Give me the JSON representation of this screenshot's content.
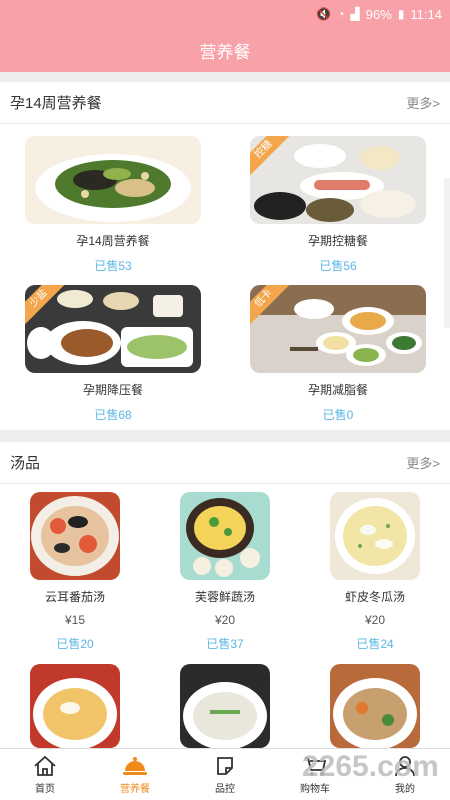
{
  "status": {
    "battery": "96%",
    "time": "11:14"
  },
  "header": {
    "title": "营养餐"
  },
  "section1": {
    "title": "孕14周营养餐",
    "more": "更多>",
    "items": [
      {
        "name": "孕14周营养餐",
        "sold": "已售53",
        "badge": ""
      },
      {
        "name": "孕期控糖餐",
        "sold": "已售56",
        "badge": "控糖"
      },
      {
        "name": "孕期降压餐",
        "sold": "已售68",
        "badge": "少盐"
      },
      {
        "name": "孕期减脂餐",
        "sold": "已售0",
        "badge": "低卡"
      }
    ]
  },
  "section2": {
    "title": "汤品",
    "more": "更多>",
    "items": [
      {
        "name": "云耳番茄汤",
        "price": "¥15",
        "sold": "已售20"
      },
      {
        "name": "芙蓉鲜蔬汤",
        "price": "¥20",
        "sold": "已售37"
      },
      {
        "name": "虾皮冬瓜汤",
        "price": "¥20",
        "sold": "已售24"
      }
    ]
  },
  "tabs": [
    {
      "label": "首页",
      "icon": "home-icon"
    },
    {
      "label": "营养餐",
      "icon": "cloche-icon"
    },
    {
      "label": "品控",
      "icon": "note-icon"
    },
    {
      "label": "购物车",
      "icon": "cart-icon"
    },
    {
      "label": "我的",
      "icon": "user-icon"
    }
  ],
  "watermark": "2265.com",
  "colors": {
    "header": "#f8a1a8",
    "accent": "#f08a18",
    "sold": "#5bb7e6"
  }
}
